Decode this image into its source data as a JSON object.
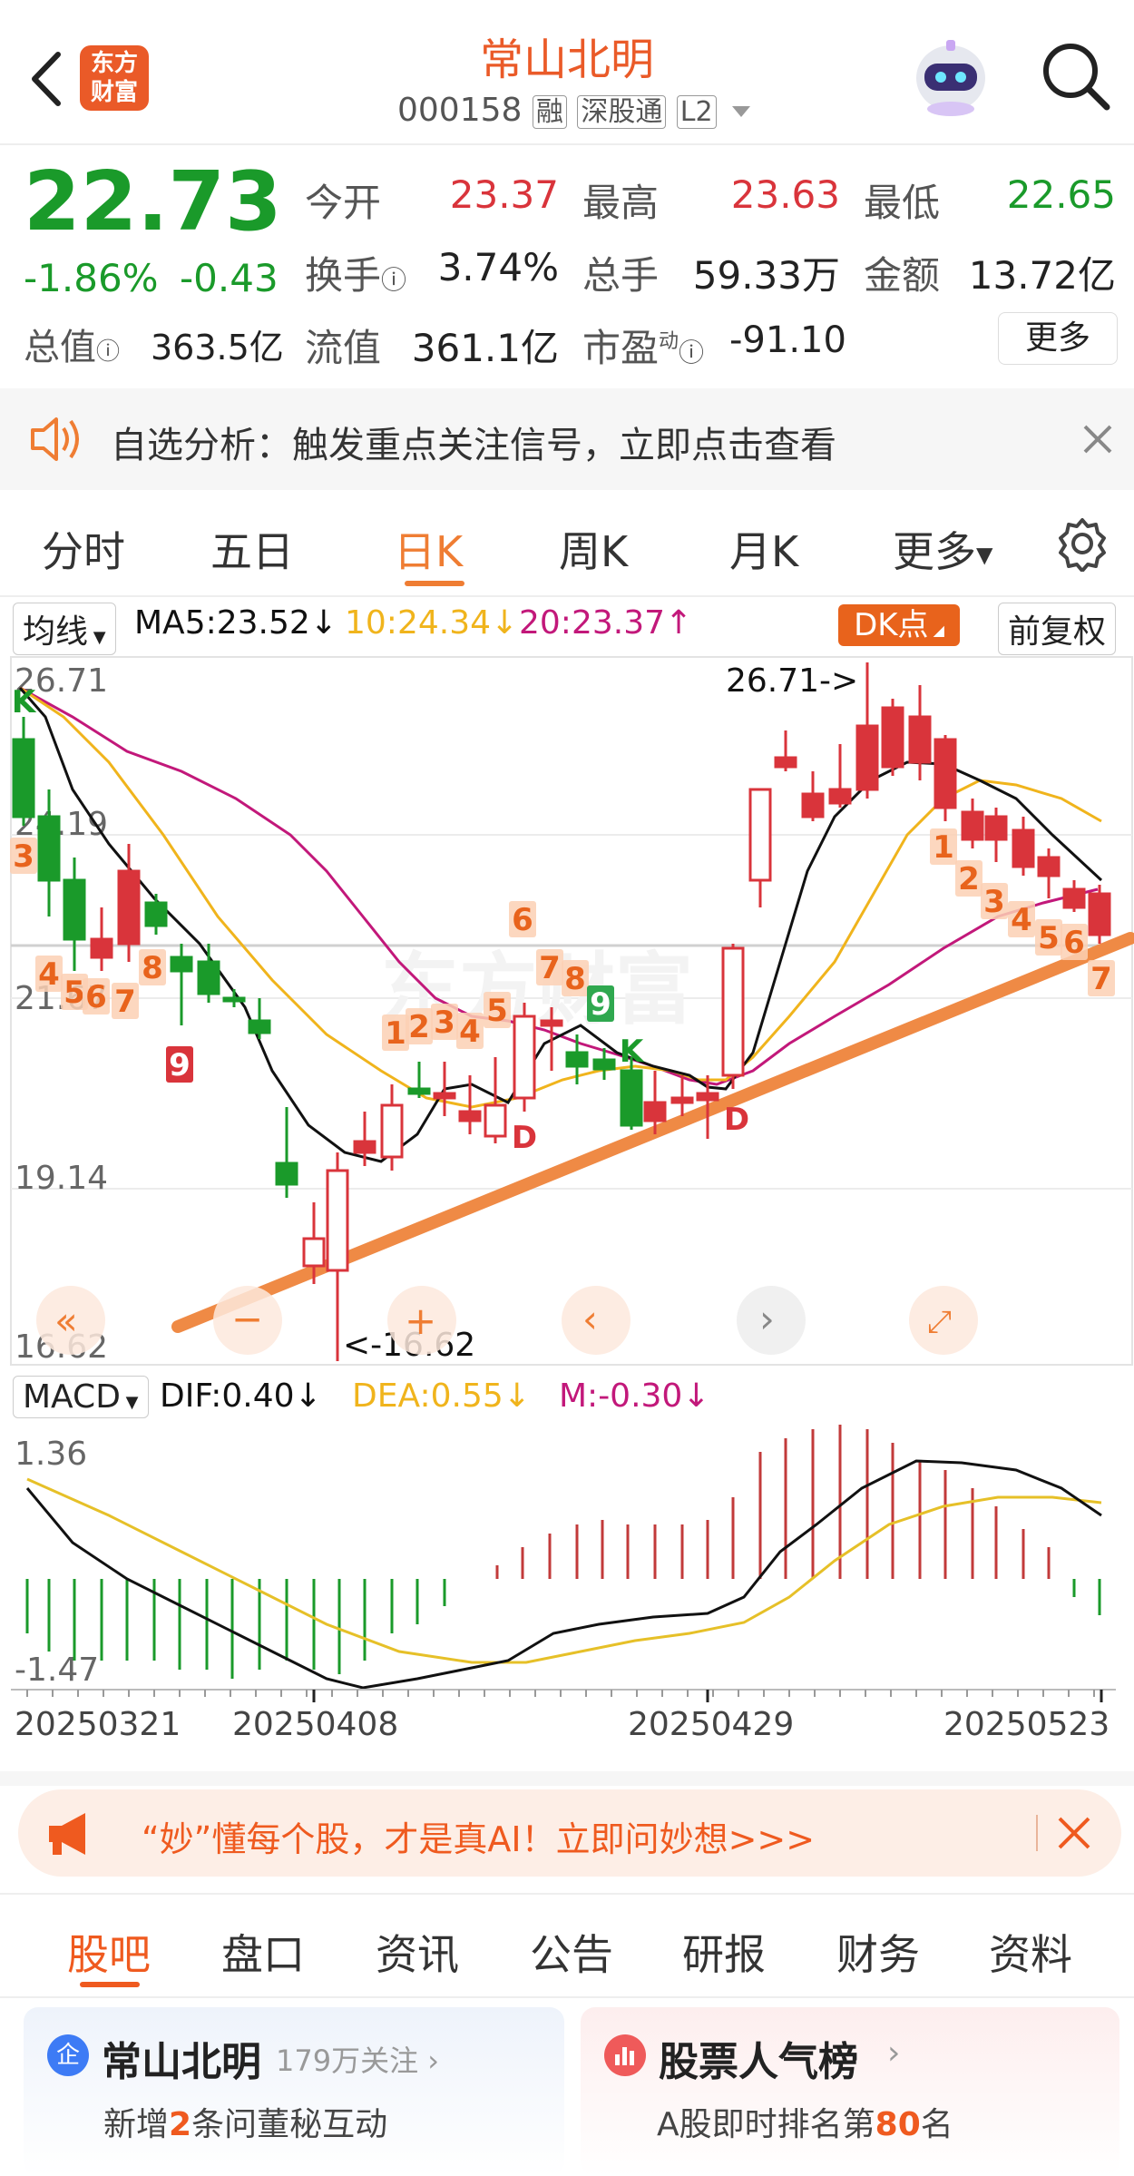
{
  "header": {
    "logo_line1": "东方",
    "logo_line2": "财富",
    "stock_name": "常山北明",
    "stock_code": "000158",
    "tag_margin": "融",
    "tag_connect": "深股通",
    "tag_level": "L2"
  },
  "quote": {
    "price": "22.73",
    "change_pct": "-1.86%",
    "change_amt": "-0.43",
    "open_label": "今开",
    "open_value": "23.37",
    "high_label": "最高",
    "high_value": "23.63",
    "low_label": "最低",
    "low_value": "22.65",
    "turnover_label": "换手",
    "turnover_value": "3.74%",
    "volume_label": "总手",
    "volume_value": "59.33万",
    "amount_label": "金额",
    "amount_value": "13.72亿",
    "mktcap_label": "总值",
    "mktcap_value": "363.5亿",
    "float_label": "流值",
    "float_value": "361.1亿",
    "pe_label": "市盈",
    "pe_sup": "动",
    "pe_value": "-91.10",
    "more_label": "更多"
  },
  "notice": {
    "text": "自选分析：触发重点关注信号，立即点击查看"
  },
  "chart_tabs": [
    "分时",
    "五日",
    "日K",
    "周K",
    "月K",
    "更多"
  ],
  "chart_toolbar": {
    "ma_select": "均线",
    "ma5": "MA5:23.52",
    "ma10": "10:24.34",
    "ma20": "20:23.37",
    "dk_label": "DK点",
    "adjust_label": "前复权"
  },
  "kline": {
    "y_labels": [
      "26.71",
      "24.19",
      "21.67",
      "19.14",
      "16.62"
    ],
    "max_label": "26.71->",
    "min_label": "<-16.62",
    "markers": [
      "K",
      "3",
      "4",
      "5",
      "6",
      "7",
      "8",
      "9",
      "1",
      "2",
      "3",
      "4",
      "5",
      "6",
      "7",
      "8",
      "9",
      "D",
      "K",
      "D",
      "1",
      "2",
      "3",
      "4",
      "5",
      "6",
      "7"
    ]
  },
  "macd_toolbar": {
    "select": "MACD",
    "dif": "DIF:0.40",
    "dea": "DEA:0.55",
    "m": "M:-0.30"
  },
  "macd": {
    "y_top": "1.36",
    "y_bottom": "-1.47",
    "dates": [
      "20250321",
      "20250408",
      "20250429",
      "20250523"
    ]
  },
  "ad_banner": {
    "text": "“妙”懂每个股，才是真AI！立即问妙想>>>"
  },
  "bottom_tabs": [
    "股吧",
    "盘口",
    "资讯",
    "公告",
    "研报",
    "财务",
    "资料"
  ],
  "cards": {
    "left_badge": "企",
    "left_title": "常山北明",
    "left_follow": "179万关注",
    "left_sub_a": "新增",
    "left_sub_num": "2",
    "left_sub_b": "条问董秘互动",
    "right_title": "股票人气榜",
    "right_sub_a": "A股即时排名第",
    "right_sub_num": "80",
    "right_sub_b": "名"
  },
  "colors": {
    "up": "#d9343b",
    "down": "#1a9a2a",
    "accent": "#ef7d33",
    "ma10": "#f0b41c",
    "ma20": "#c2187a"
  }
}
